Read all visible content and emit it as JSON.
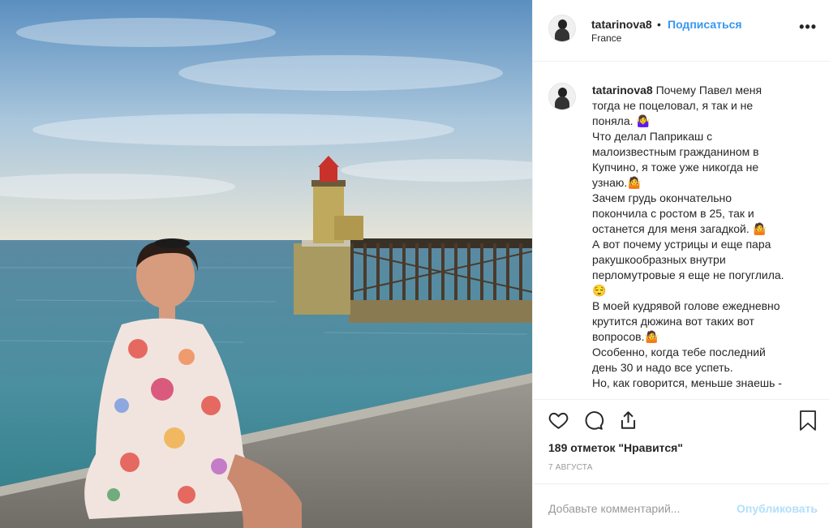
{
  "post": {
    "username": "tatarinova8",
    "separator": "•",
    "follow_label": "Подписаться",
    "location": "France",
    "more_label": "•••"
  },
  "caption": {
    "username": "tatarinova8",
    "lines": [
      "Почему Павел меня",
      "тогда не поцеловал, я так и не",
      "поняла. 🤷‍♀️",
      "Что делал Паприкаш с",
      "малоизвестным гражданином в",
      "Купчино, я тоже уже никогда не",
      "узнаю.🤷",
      "Зачем грудь окончательно",
      "покончила с ростом в 25, так и",
      "останется для меня загадкой. 🤷",
      "А вот почему устрицы и еще пара",
      "ракушкообразных внутри",
      "перломутровые я еще не погуглила.",
      "😌",
      "В моей кудрявой голове ежедневно",
      "крутится дюжина вот таких вот",
      "вопросов.🤷",
      "Особенно, когда тебе последний",
      "день 30 и надо все успеть.",
      "Но, как говорится, меньше знаешь -"
    ]
  },
  "actions": {
    "like_icon": "heart-icon",
    "comment_icon": "comment-icon",
    "share_icon": "share-icon",
    "save_icon": "bookmark-icon"
  },
  "likes_text": "189 отметок \"Нравится\"",
  "date_text": "7 АВГУСТА",
  "comment_box": {
    "placeholder": "Добавьте комментарий...",
    "post_label": "Опубликовать"
  },
  "colors": {
    "link": "#3897f0",
    "post_disabled": "#b2dffc",
    "border": "#efefef"
  }
}
